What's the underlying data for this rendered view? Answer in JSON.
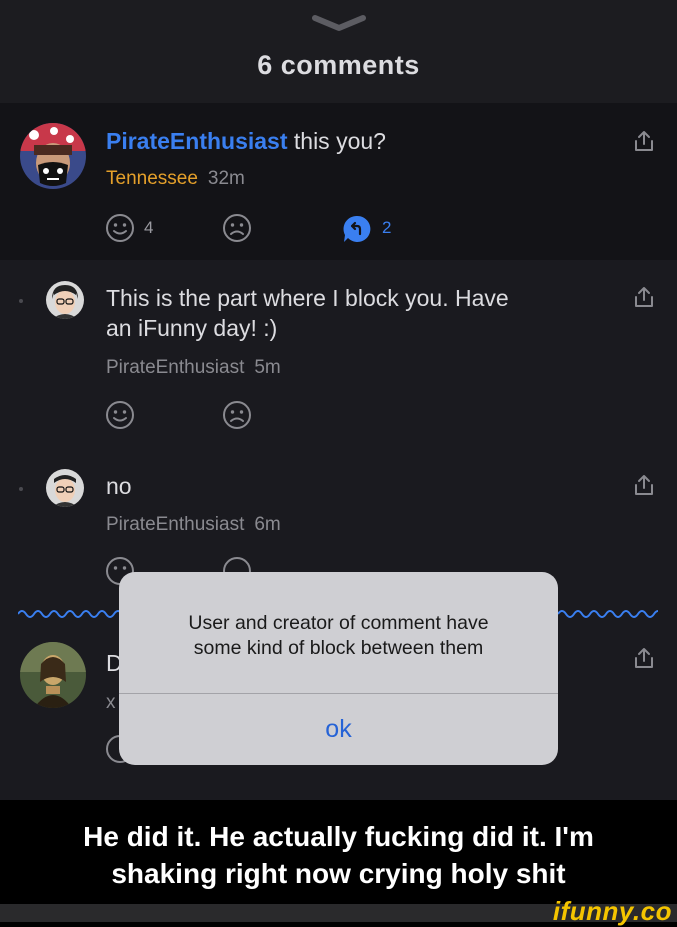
{
  "header": {
    "title": "6 comments"
  },
  "comments": [
    {
      "username": "PirateEnthusiast",
      "text": "this you?",
      "location": "Tennessee",
      "time": "32m",
      "smile_count": "4",
      "reply_count": "2"
    },
    {
      "text_line1": "This is the part where I block you. Have",
      "text_line2": "an iFunny day! :)",
      "author": "PirateEnthusiast",
      "time": "5m"
    },
    {
      "text": "no",
      "author": "PirateEnthusiast",
      "time": "6m"
    },
    {
      "text_partial": "D",
      "meta_partial": "x"
    }
  ],
  "dialog": {
    "message_line1": "User and creator of comment have",
    "message_line2": "some kind of block between them",
    "ok_label": "ok"
  },
  "caption": {
    "line1": "He did it. He actually fucking did it. I'm",
    "line2": "shaking right now crying holy shit"
  },
  "watermark": "ifunny.co",
  "colors": {
    "username_blue": "#3a7ff0",
    "location_orange": "#e5a02a",
    "dialog_button_blue": "#2663d6",
    "watermark_yellow": "#f4c400"
  },
  "icons": [
    "chevron-down-icon",
    "share-icon",
    "smile-icon",
    "frown-icon",
    "reply-bubble-icon"
  ]
}
